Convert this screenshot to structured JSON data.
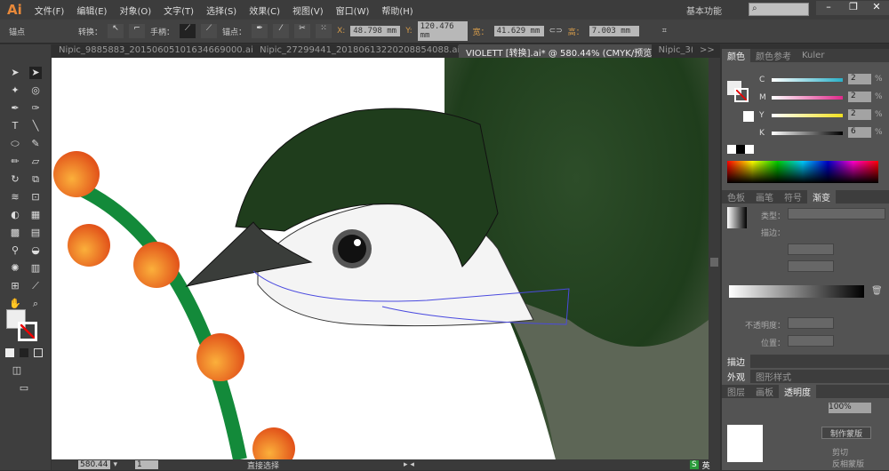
{
  "app": {
    "logo": "Ai",
    "workspace": "基本功能",
    "search_placeholder": ""
  },
  "menu": [
    "文件(F)",
    "编辑(E)",
    "对象(O)",
    "文字(T)",
    "选择(S)",
    "效果(C)",
    "视图(V)",
    "窗口(W)",
    "帮助(H)"
  ],
  "control": {
    "context": "锚点",
    "convert": "转换：",
    "handles": "手柄：",
    "anchors": "锚点：",
    "x_label": "X:",
    "x": "48.798 mm",
    "y_label": "Y:",
    "y": "120.476 mm",
    "w_label": "宽：",
    "w": "41.629 mm",
    "h_label": "高：",
    "h": "7.003 mm"
  },
  "tabs": [
    {
      "label": "Nipic_9885883_20150605101634669000.ai* ×",
      "active": false
    },
    {
      "label": "Nipic_27299441_20180613220208854088.ai* ×",
      "active": false
    },
    {
      "label": "VIOLETT [转换].ai* @ 580.44% (CMYK/预览)  ×",
      "active": true
    },
    {
      "label": "Nipic_3(",
      "active": false
    }
  ],
  "tabs_overflow": ">>",
  "status": {
    "zoom": "580.44",
    "page": "1",
    "tool": "直接选择"
  },
  "color_panel": {
    "tabs": [
      "颜色",
      "颜色参考",
      "Kuler"
    ],
    "channels": [
      {
        "name": "C",
        "value": "2",
        "color": "#2ab0c8"
      },
      {
        "name": "M",
        "value": "2",
        "color": "#e0288a"
      },
      {
        "name": "Y",
        "value": "2",
        "color": "#f0e020"
      },
      {
        "name": "K",
        "value": "6",
        "color": "#000000"
      }
    ],
    "unit": "%"
  },
  "gradient_panel": {
    "tabs": [
      "色板",
      "画笔",
      "符号",
      "渐变"
    ],
    "type_label": "类型：",
    "stroke_label": "描边：",
    "opacity_label": "不透明度：",
    "position_label": "位置："
  },
  "stroke_panel": {
    "title": "描边"
  },
  "appearance_panel": {
    "tabs": [
      "外观",
      "图形样式"
    ]
  },
  "transparency_panel": {
    "tabs": [
      "图层",
      "画板",
      "透明度"
    ],
    "opacity": "100%",
    "make_mask": "制作蒙版",
    "clip": "剪切",
    "invert": "反相蒙版"
  },
  "taskbar": {
    "ime": "英"
  },
  "colors": {
    "accent": "#e8893a",
    "bird_green": "#1f3d1c",
    "branch": "#138a3a",
    "berry": "#f07a1a"
  }
}
